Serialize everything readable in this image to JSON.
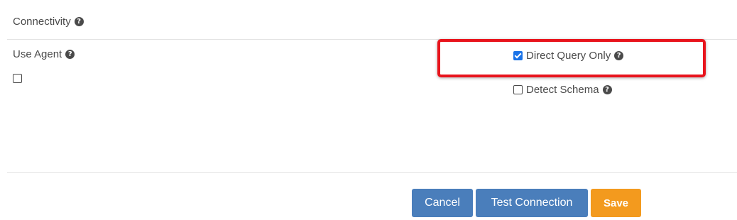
{
  "section": {
    "title": "Connectivity"
  },
  "fields": {
    "use_agent": {
      "label": "Use Agent",
      "checked": false
    },
    "direct_query_only": {
      "label": "Direct Query Only",
      "checked": true
    },
    "detect_schema": {
      "label": "Detect Schema",
      "checked": false
    }
  },
  "help_icon_glyph": "?",
  "buttons": {
    "cancel": "Cancel",
    "test_connection": "Test Connection",
    "save": "Save"
  },
  "colors": {
    "primary_button": "#4a7ebb",
    "save_button": "#f39a1e",
    "highlight": "#e8141c",
    "checkbox_checked": "#1a73e8"
  }
}
